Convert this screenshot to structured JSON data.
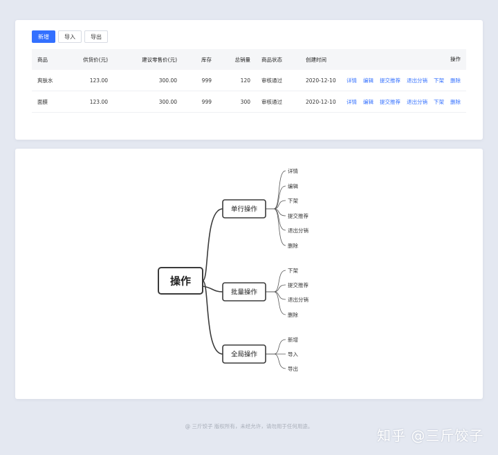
{
  "toolbar": {
    "add": "新增",
    "import": "导入",
    "export": "导出"
  },
  "table": {
    "headers": [
      "商品",
      "供货价(元)",
      "建议零售价(元)",
      "库存",
      "总销量",
      "商品状态",
      "创建时间",
      "操作"
    ],
    "rows": [
      {
        "name": "爽肤水",
        "supply_price": "123.00",
        "retail_price": "300.00",
        "stock": "999",
        "sales": "120",
        "status": "审核通过",
        "created": "2020-12-10"
      },
      {
        "name": "面膜",
        "supply_price": "123.00",
        "retail_price": "300.00",
        "stock": "999",
        "sales": "300",
        "status": "审核通过",
        "created": "2020-12-10"
      }
    ],
    "row_actions": [
      "详情",
      "编辑",
      "提交推荐",
      "退出分销",
      "下架",
      "删除"
    ]
  },
  "mindmap": {
    "root": "操作",
    "branches": [
      {
        "label": "单行操作",
        "leaves": [
          "详情",
          "编辑",
          "下架",
          "提交推荐",
          "退出分销",
          "删除"
        ]
      },
      {
        "label": "批量操作",
        "leaves": [
          "下架",
          "提交推荐",
          "退出分销",
          "删除"
        ]
      },
      {
        "label": "全局操作",
        "leaves": [
          "新增",
          "导入",
          "导出"
        ]
      }
    ]
  },
  "footer": {
    "copyright": "@ 三斤饺子  版权所有，未经允许，请勿用于任何用途。",
    "watermark": "知乎 @三斤饺子"
  },
  "colors": {
    "primary": "#3370ff",
    "background": "#e4e8f1",
    "header_bg": "#f5f6f8"
  }
}
